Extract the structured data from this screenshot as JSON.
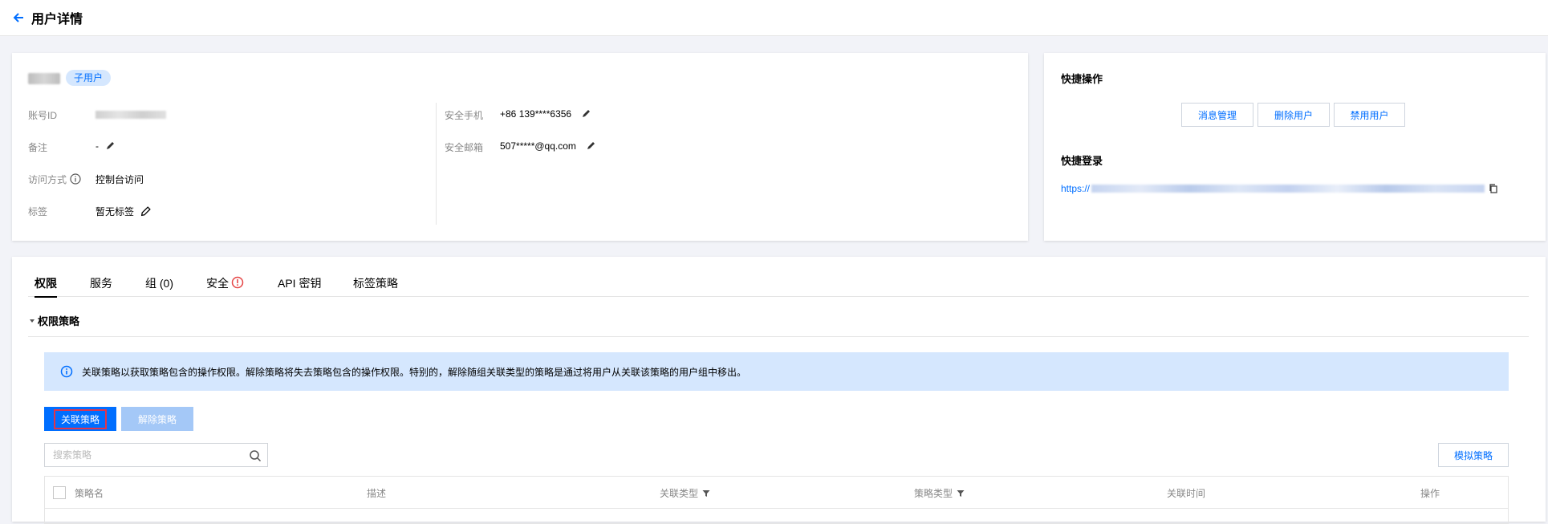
{
  "header": {
    "title": "用户详情"
  },
  "user": {
    "badge": "子用户",
    "left_fields": [
      {
        "label": "账号ID"
      },
      {
        "label": "备注",
        "value": "-"
      },
      {
        "label": "访问方式",
        "value": "控制台访问"
      },
      {
        "label": "标签",
        "value": "暂无标签"
      }
    ],
    "right_fields": [
      {
        "label": "安全手机",
        "value": "+86 139****6356"
      },
      {
        "label": "安全邮箱",
        "value": "507*****@qq.com"
      }
    ]
  },
  "quick_ops": {
    "title": "快捷操作",
    "buttons": [
      "消息管理",
      "删除用户",
      "禁用用户"
    ],
    "login_title": "快捷登录",
    "login_link_prefix": "https://"
  },
  "tabs": [
    {
      "label": "权限",
      "active": true
    },
    {
      "label": "服务"
    },
    {
      "label": "组 (0)"
    },
    {
      "label": "安全",
      "icon": "alert-circle-icon"
    },
    {
      "label": "API 密钥"
    },
    {
      "label": "标签策略"
    }
  ],
  "policy_section": {
    "title": "权限策略",
    "notice": "关联策略以获取策略包含的操作权限。解除策略将失去策略包含的操作权限。特别的，解除随组关联类型的策略是通过将用户从关联该策略的用户组中移出。",
    "attach_button": "关联策略",
    "detach_button": "解除策略",
    "search_placeholder": "搜索策略",
    "simulate_button": "模拟策略",
    "columns": [
      "策略名",
      "描述",
      "关联类型",
      "策略类型",
      "关联时间",
      "操作"
    ]
  },
  "colors": {
    "accent": "#006eff",
    "notice_bg": "#d5e7fe",
    "highlight": "#e2344b",
    "page_bg": "#f2f3f8"
  }
}
